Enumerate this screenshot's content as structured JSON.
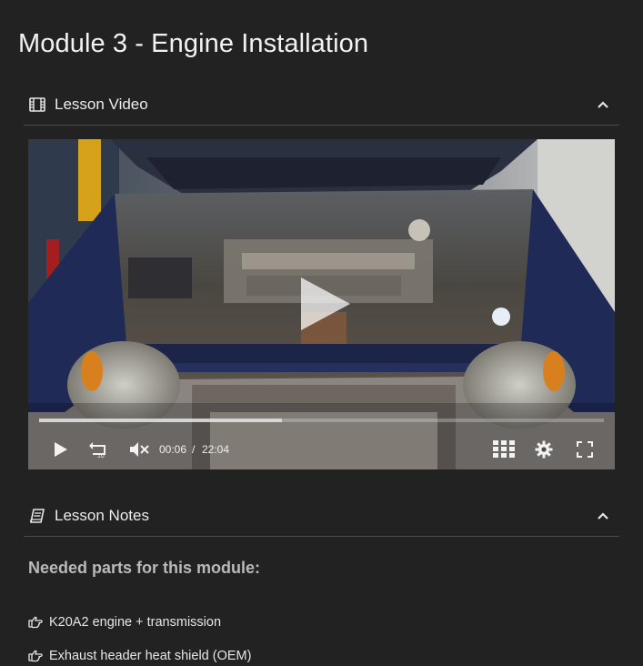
{
  "module": {
    "title": "Module 3 - Engine Installation"
  },
  "video_section": {
    "title": "Lesson Video",
    "icon": "film-icon",
    "collapse_icon": "chevron-up-icon"
  },
  "video_player": {
    "current_time": "00:06",
    "separator": "/",
    "duration": "22:04",
    "progress": 0.43,
    "controls": [
      "play-icon",
      "rewind-10-icon",
      "mute-icon",
      "grid-icon",
      "settings-icon",
      "fullscreen-icon"
    ]
  },
  "notes_section": {
    "title": "Lesson Notes",
    "icon": "book-icon",
    "collapse_icon": "chevron-up-icon",
    "heading": "Needed parts for this module:",
    "parts": [
      "K20A2 engine + transmission",
      "Exhaust header heat shield (OEM)"
    ],
    "bullet_icon": "hand-pointing-right-icon"
  }
}
